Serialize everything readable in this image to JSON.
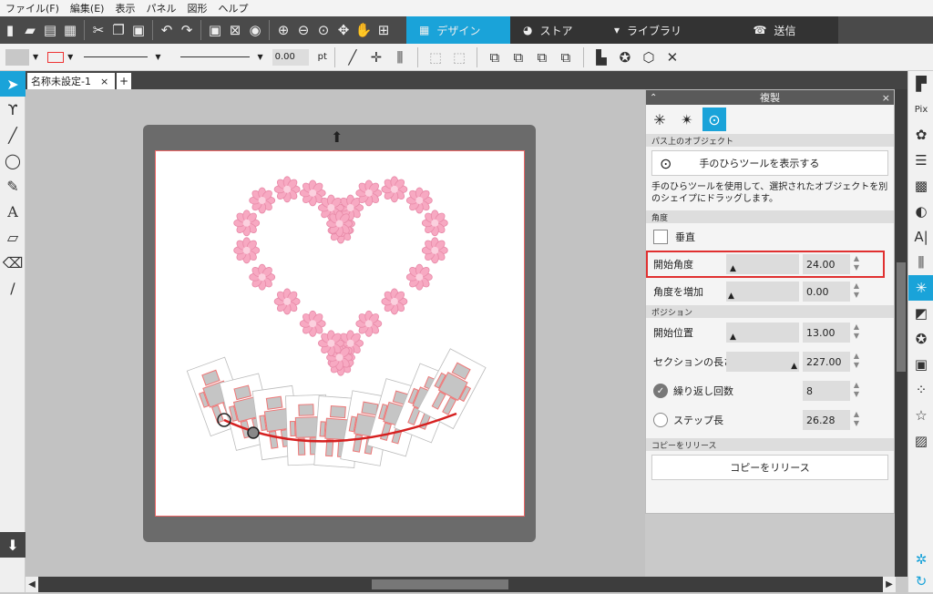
{
  "menubar": [
    "ファイル(F)",
    "編集(E)",
    "表示",
    "パネル",
    "図形",
    "ヘルプ"
  ],
  "nav_tabs": [
    {
      "label": "デザイン",
      "icon": "grid-icon",
      "active": true
    },
    {
      "label": "ストア",
      "icon": "store-icon",
      "active": false
    },
    {
      "label": "ライブラリ",
      "icon": "library-icon",
      "active": false
    },
    {
      "label": "送信",
      "icon": "send-icon",
      "active": false
    }
  ],
  "toolbar2": {
    "line_width": "0.00",
    "unit": "pt"
  },
  "doc_tab": {
    "title": "名称未設定-1",
    "close": "×",
    "add": "+"
  },
  "panel": {
    "title": "複製",
    "close": "×",
    "section_path": "パス上のオブジェクト",
    "hand_tool_button": "手のひらツールを表示する",
    "description": "手のひらツールを使用して、選択されたオブジェクトを別のシェイプにドラッグします。",
    "section_angle": "角度",
    "vertical_label": "垂直",
    "start_angle_label": "開始角度",
    "start_angle_value": "24.00",
    "angle_increase_label": "角度を増加",
    "angle_increase_value": "0.00",
    "section_position": "ポジション",
    "start_pos_label": "開始位置",
    "start_pos_value": "13.00",
    "section_length_label": "セクションの長さ",
    "section_length_value": "227.00",
    "repeat_label": "繰り返し回数",
    "repeat_value": "8",
    "step_label": "ステップ長",
    "step_value": "26.28",
    "section_release": "コピーをリリース",
    "release_button": "コピーをリリース"
  },
  "accent_color": "#1aa3d9",
  "highlight_color": "#e03030"
}
